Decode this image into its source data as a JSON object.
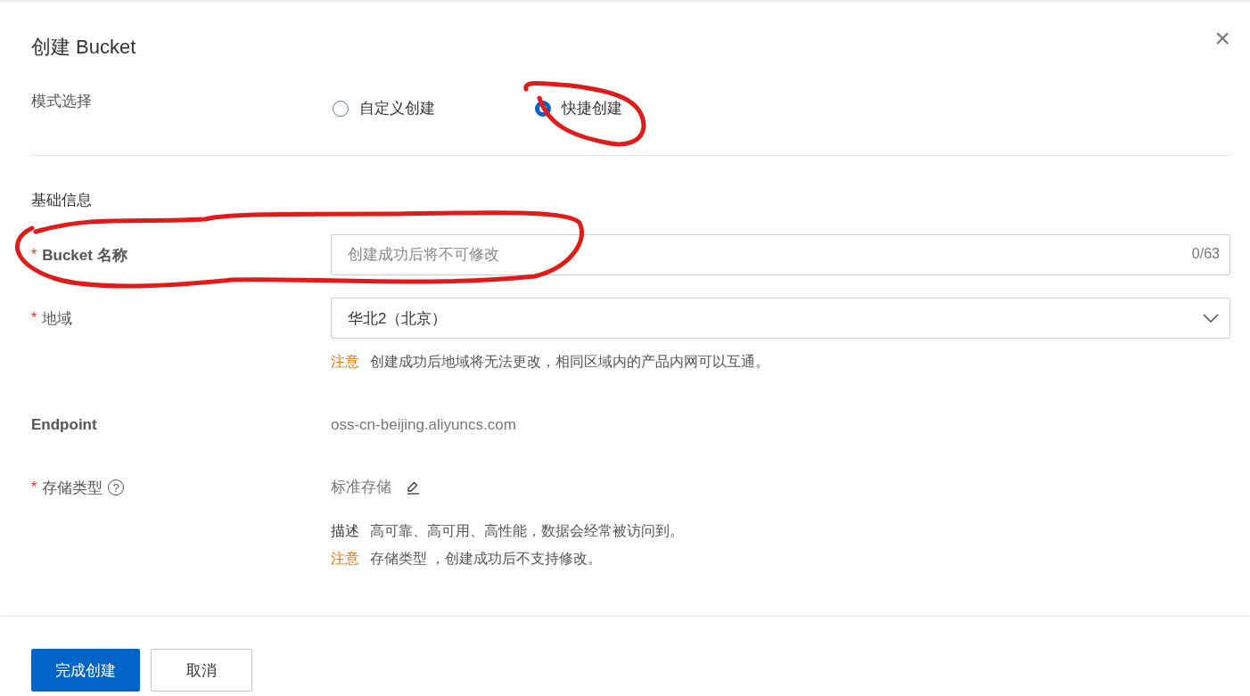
{
  "dialog": {
    "title": "创建 Bucket",
    "close": "×"
  },
  "mode": {
    "label": "模式选择",
    "options": [
      {
        "label": "自定义创建",
        "selected": false
      },
      {
        "label": "快捷创建",
        "selected": true
      }
    ]
  },
  "section": "基础信息",
  "fields": [
    {
      "kind": "input",
      "label": "Bucket 名称",
      "required_mark": "*",
      "placeholder": "创建成功后将不可修改",
      "counter": "0/63"
    },
    {
      "kind": "select",
      "label": "地域",
      "required_mark": "*",
      "value": "华北2（北京）",
      "notes": [
        {
          "tag": "注意",
          "text": "创建成功后地域将无法更改，相同区域内的产品内网可以互通。",
          "kind": "warning"
        }
      ]
    },
    {
      "kind": "text",
      "label": "Endpoint",
      "value": "oss-cn-beijing.aliyuncs.com"
    },
    {
      "kind": "editable",
      "label": "存储类型",
      "required_mark": "*",
      "help": "?",
      "value": "标准存储",
      "notes": [
        {
          "tag": "描述",
          "text": "高可靠、高可用、高性能，数据会经常被访问到。",
          "kind": "info"
        },
        {
          "tag": "注意",
          "text": "存储类型 ，创建成功后不支持修改。",
          "kind": "warning"
        }
      ]
    }
  ],
  "buttons": [
    {
      "label": "完成创建",
      "kind": "primary"
    },
    {
      "label": "取消",
      "kind": "secondary"
    }
  ]
}
